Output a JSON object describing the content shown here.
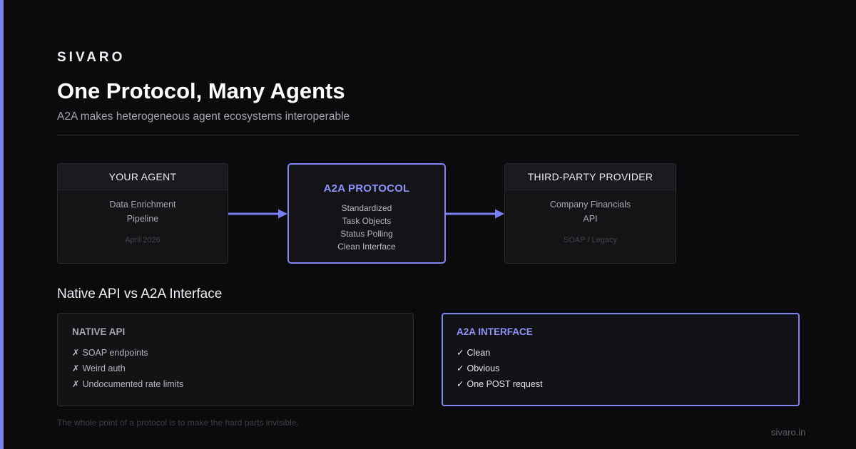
{
  "brand": "SIVARO",
  "title": "One Protocol, Many Agents",
  "subtitle": "A2A makes heterogeneous agent ecosystems interoperable",
  "flow": {
    "your_agent": {
      "header": "YOUR AGENT",
      "lines": [
        "Data Enrichment",
        "Pipeline"
      ],
      "footer": "April 2026"
    },
    "protocol": {
      "title": "A2A PROTOCOL",
      "items": [
        "Standardized",
        "Task Objects",
        "Status Polling",
        "Clean Interface"
      ]
    },
    "third_party": {
      "header": "THIRD-PARTY PROVIDER",
      "lines": [
        "Company Financials",
        "API"
      ],
      "footer": "SOAP / Legacy"
    }
  },
  "comparison": {
    "title": "Native API vs A2A Interface",
    "native": {
      "title": "NATIVE API",
      "mark": "✗",
      "items": [
        "SOAP endpoints",
        "Weird auth",
        "Undocumented rate limits"
      ]
    },
    "a2a": {
      "title": "A2A INTERFACE",
      "mark": "✓",
      "items": [
        "Clean",
        "Obvious",
        "One POST request"
      ]
    }
  },
  "footnote": "The whole point of a protocol is to make the hard parts invisible.",
  "site": "sivaro.in",
  "colors": {
    "accent": "#7b80f0",
    "background": "#0b0b0d"
  }
}
